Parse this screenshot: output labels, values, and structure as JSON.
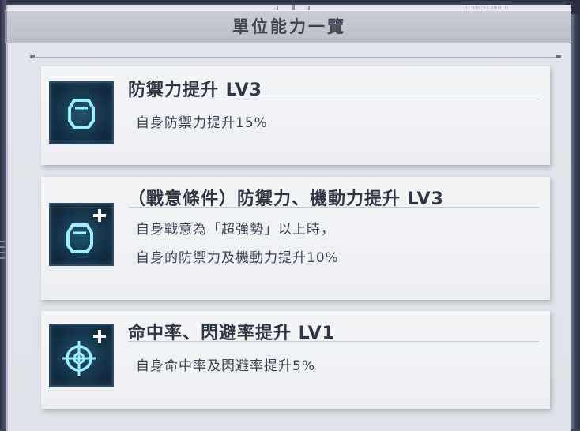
{
  "window": {
    "title": "單位能力一覽",
    "corner_code": "II IBCEI-IRII II"
  },
  "abilities": [
    {
      "title": "防禦力提升 LV3",
      "icon": "shield-icon",
      "description": [
        "自身防禦力提升15%"
      ]
    },
    {
      "title": "（戰意條件）防禦力、機動力提升 LV3",
      "icon": "shield-plus-icon",
      "description": [
        "自身戰意為「超強勢」以上時，",
        "自身的防禦力及機動力提升10%"
      ]
    },
    {
      "title": "命中率、閃避率提升 LV1",
      "icon": "crosshair-plus-icon",
      "description": [
        "自身命中率及閃避率提升5%"
      ]
    }
  ],
  "colors": {
    "panel": "#e3e6ec",
    "card": "#f1f2f5",
    "icon_bg": "#12283a",
    "icon_glow": "#8fe3ff",
    "title_bar": "#c3c7d0"
  }
}
